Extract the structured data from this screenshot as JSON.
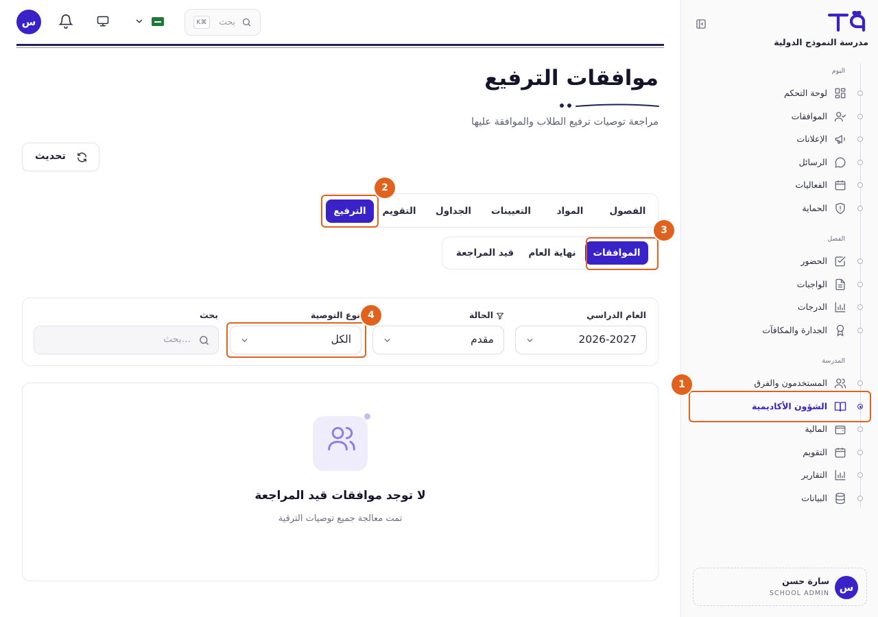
{
  "sidebar": {
    "school_name": "مدرسة النموذج الدولية",
    "sections": [
      {
        "label": "اليوم",
        "items": [
          {
            "label": "لوحة التحكم",
            "icon": "dashboard-icon"
          },
          {
            "label": "الموافقات",
            "icon": "user-check-icon"
          },
          {
            "label": "الإعلانات",
            "icon": "megaphone-icon"
          },
          {
            "label": "الرسائل",
            "icon": "message-icon"
          },
          {
            "label": "الفعاليات",
            "icon": "calendar-grid-icon"
          },
          {
            "label": "الحماية",
            "icon": "shield-icon"
          }
        ]
      },
      {
        "label": "الفصل",
        "items": [
          {
            "label": "الحضور",
            "icon": "check-square-icon"
          },
          {
            "label": "الواجبات",
            "icon": "document-icon"
          },
          {
            "label": "الدرجات",
            "icon": "bar-chart-icon"
          },
          {
            "label": "الجدارة والمكافآت",
            "icon": "award-icon"
          }
        ]
      },
      {
        "label": "المدرسة",
        "items": [
          {
            "label": "المستخدمون والفرق",
            "icon": "users-icon"
          },
          {
            "label": "الشؤون الأكاديمية",
            "icon": "book-open-icon",
            "active": true
          },
          {
            "label": "المالية",
            "icon": "wallet-icon"
          },
          {
            "label": "التقويم",
            "icon": "calendar-icon"
          },
          {
            "label": "التقارير",
            "icon": "bar-chart-icon"
          },
          {
            "label": "البيانات",
            "icon": "database-icon"
          }
        ]
      }
    ],
    "user": {
      "avatar": "س",
      "name": "سارة حسن",
      "role": "SCHOOL ADMIN"
    }
  },
  "topbar": {
    "avatar": "س",
    "search_placeholder": "بحث",
    "search_shortcut": "K⌘",
    "flag": "saudi-flag-icon"
  },
  "header": {
    "title": "موافقات الترفيع",
    "subtitle": "مراجعة توصيات ترفيع الطلاب والموافقة عليها",
    "refresh_label": "تحديث"
  },
  "tabs": {
    "main": [
      "الفصول",
      "المواد",
      "التعيينات",
      "الجداول",
      "التقويم",
      "الترفيع"
    ],
    "main_active": "الترفيع",
    "sub": [
      "الموافقات",
      "نهاية العام",
      "قيد المراجعة"
    ],
    "sub_active": "الموافقات"
  },
  "filters": {
    "year_label": "العام الدراسي",
    "year_value": "2026-2027",
    "status_label": "الحالة",
    "status_value": "مقدم",
    "type_label": "نوع التوصية",
    "type_value": "الكل",
    "search_label": "بحث",
    "search_placeholder": "بحث..."
  },
  "empty_state": {
    "title": "لا توجد موافقات قيد المراجعة",
    "subtitle": "تمت معالجة جميع توصيات الترقية"
  },
  "annotations": [
    "1",
    "2",
    "3",
    "4"
  ],
  "colors": {
    "accent": "#3a22c9",
    "annotation": "#e0621c",
    "navy_line": "#1f2256"
  }
}
